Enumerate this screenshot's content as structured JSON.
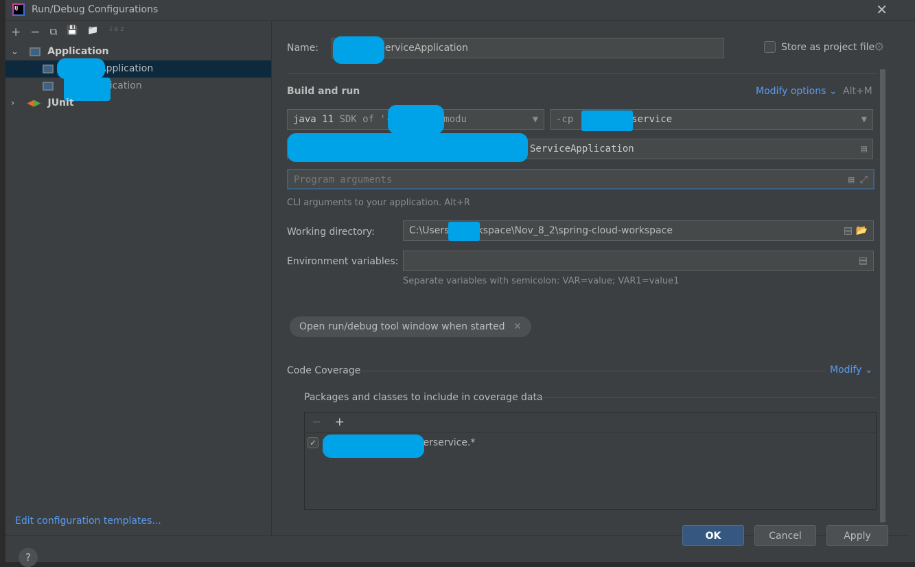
{
  "window": {
    "title": "Run/Debug Configurations",
    "close": "✕"
  },
  "toolbar": {
    "add": "+",
    "remove": "−",
    "copy": "⧉",
    "save": "💾",
    "folder": "📁",
    "sort": "↓a z"
  },
  "tree": {
    "groups": [
      {
        "label": "Application",
        "expanded": true
      },
      {
        "label": "JUnit",
        "expanded": false
      }
    ],
    "items": [
      {
        "label": "ServiceApplication",
        "visible_suffix": "erviceApplication",
        "selected": true
      },
      {
        "label": "ceApplication",
        "selected": false
      }
    ]
  },
  "edit_templates": "Edit configuration templates...",
  "form": {
    "name_label": "Name:",
    "name_value": "ServiceApplication",
    "store_label": "Store as project file",
    "store_checked": false,
    "section": "Build and run",
    "modify_options": "Modify options",
    "modify_shortcut": "Alt+M",
    "jdk": "java 11",
    "jdk_rest": "SDK of '-service' modu",
    "cp_prefix": "-cp",
    "cp_value": "-service",
    "main_class": "ServiceApplication",
    "program_args_placeholder": "Program arguments",
    "cli_hint": "CLI arguments to your application. Alt+R",
    "workdir_label": "Working directory:",
    "workdir_value": "C:\\Users\\      \\Workspace\\Nov_8_2\\spring-cloud-workspace",
    "env_label": "Environment variables:",
    "env_value": "",
    "env_hint": "Separate variables with semicolon: VAR=value; VAR1=value1",
    "chip": "Open run/debug tool window when started",
    "coverage": "Code Coverage",
    "coverage_modify": "Modify",
    "packages_label": "Packages and classes to include in coverage data",
    "package_item": "erservice.*",
    "package_checked": true
  },
  "buttons": {
    "help": "?",
    "ok": "OK",
    "cancel": "Cancel",
    "apply": "Apply"
  },
  "colors": {
    "accent": "#589df6",
    "background": "#3c3f41",
    "selection": "#0d293e",
    "redaction": "#00a2e8"
  }
}
